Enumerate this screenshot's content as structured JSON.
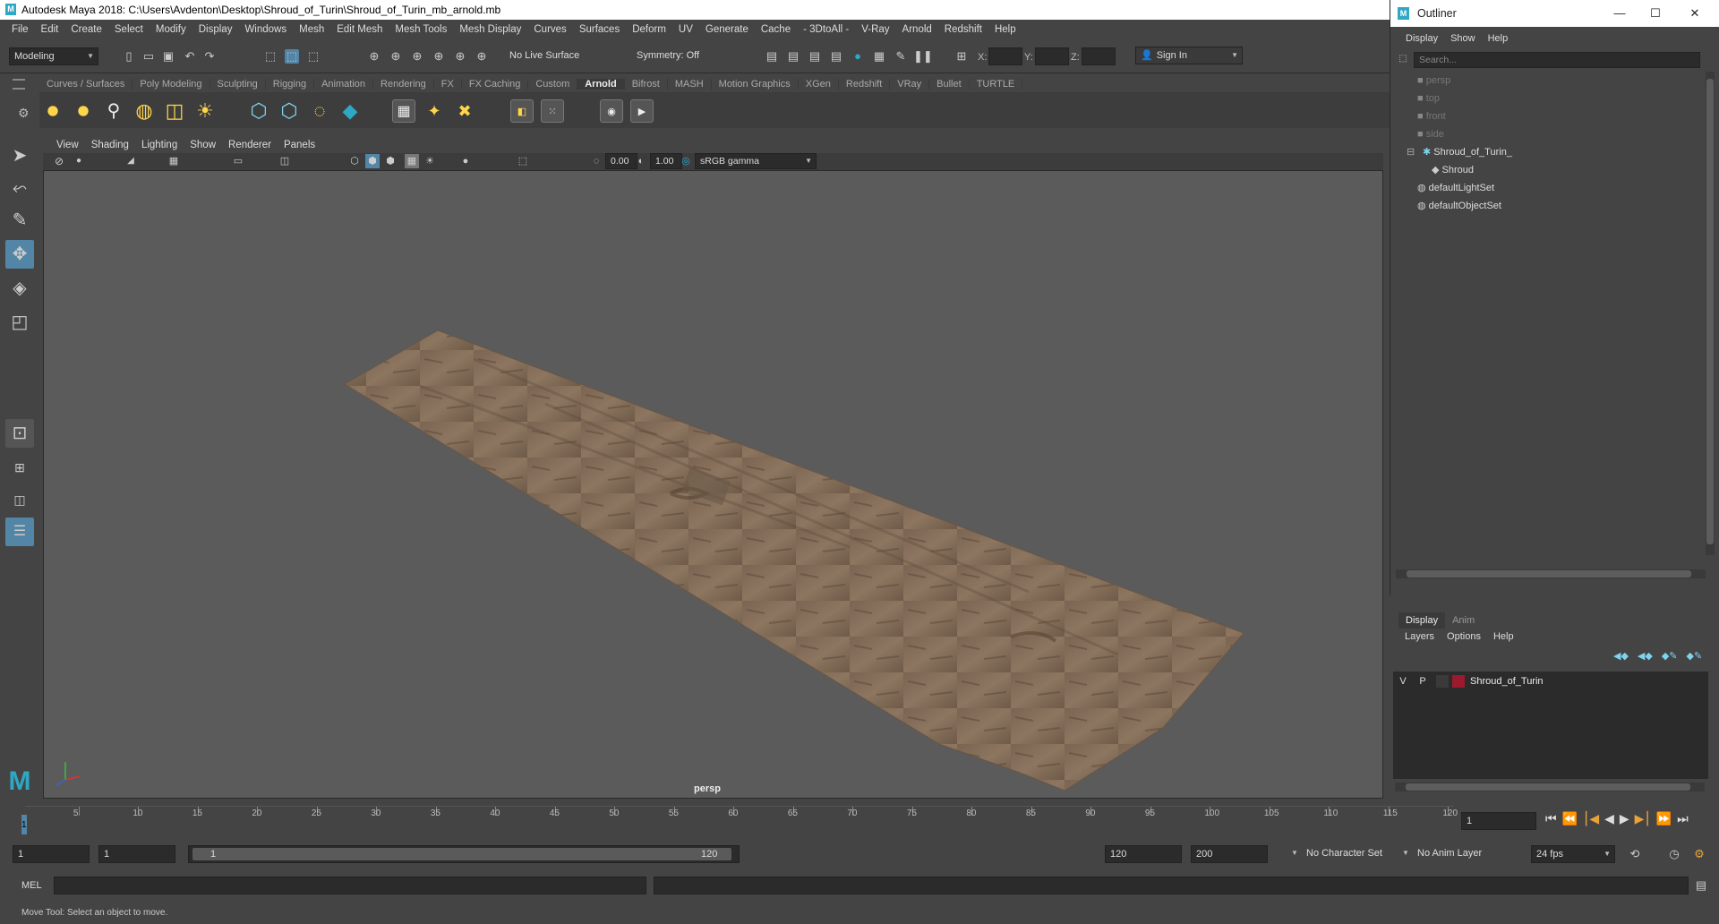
{
  "window": {
    "title": "Autodesk Maya 2018: C:\\Users\\Avdenton\\Desktop\\Shroud_of_Turin\\Shroud_of_Turin_mb_arnold.mb",
    "logo": "M"
  },
  "menubar": [
    "File",
    "Edit",
    "Create",
    "Select",
    "Modify",
    "Display",
    "Windows",
    "Mesh",
    "Edit Mesh",
    "Mesh Tools",
    "Mesh Display",
    "Curves",
    "Surfaces",
    "Deform",
    "UV",
    "Generate",
    "Cache",
    "- 3DtoAll -",
    "V-Ray",
    "Arnold",
    "Redshift",
    "Help"
  ],
  "statusline": {
    "mode": "Modeling",
    "live_surface": "No Live Surface",
    "symmetry": "Symmetry: Off",
    "x_label": "X:",
    "y_label": "Y:",
    "z_label": "Z:",
    "sign_in": "Sign In"
  },
  "shelf_tabs": [
    "Curves / Surfaces",
    "Poly Modeling",
    "Sculpting",
    "Rigging",
    "Animation",
    "Rendering",
    "FX",
    "FX Caching",
    "Custom",
    "Arnold",
    "Bifrost",
    "MASH",
    "Motion Graphics",
    "XGen",
    "Redshift",
    "VRay",
    "Bullet",
    "TURTLE"
  ],
  "active_shelf_tab": "Arnold",
  "viewport": {
    "menu": [
      "View",
      "Shading",
      "Lighting",
      "Show",
      "Renderer",
      "Panels"
    ],
    "exposure": "0.00",
    "gamma": "1.00",
    "color_space": "sRGB gamma",
    "camera_label": "persp"
  },
  "timeslider": {
    "ticks": [
      "5",
      "10",
      "15",
      "20",
      "25",
      "30",
      "35",
      "40",
      "45",
      "50",
      "55",
      "60",
      "65",
      "70",
      "75",
      "80",
      "85",
      "90",
      "95",
      "100",
      "105",
      "110",
      "115",
      "120"
    ],
    "start_tick": "1",
    "current_frame": "1"
  },
  "range": {
    "start": "1",
    "playback_start": "1",
    "range_start_label": "1",
    "range_end_label": "120",
    "playback_end": "120",
    "end": "200",
    "character_set": "No Character Set",
    "anim_layer": "No Anim Layer",
    "fps": "24 fps"
  },
  "cmdline": {
    "lang": "MEL"
  },
  "helpline": "Move Tool: Select an object to move.",
  "outliner": {
    "title": "Outliner",
    "menu": [
      "Display",
      "Show",
      "Help"
    ],
    "search_placeholder": "Search...",
    "items": [
      {
        "label": "persp",
        "icon": "camera-icon",
        "dim": true
      },
      {
        "label": "top",
        "icon": "camera-icon",
        "dim": true
      },
      {
        "label": "front",
        "icon": "camera-icon",
        "dim": true
      },
      {
        "label": "side",
        "icon": "camera-icon",
        "dim": true
      },
      {
        "label": "Shroud_of_Turin_",
        "icon": "group-icon",
        "dim": false
      },
      {
        "label": "Shroud",
        "icon": "mesh-icon",
        "dim": false
      },
      {
        "label": "defaultLightSet",
        "icon": "set-icon",
        "dim": false
      },
      {
        "label": "defaultObjectSet",
        "icon": "set-icon",
        "dim": false
      }
    ]
  },
  "layer_editor": {
    "tabs": [
      "Display",
      "Anim"
    ],
    "menu": [
      "Layers",
      "Options",
      "Help"
    ],
    "layer": {
      "v": "V",
      "p": "P",
      "name": "Shroud_of_Turin",
      "color": "#9b1a2e"
    }
  },
  "colors": {
    "accent": "#5285a6",
    "maya_blue": "#2ea8c4"
  }
}
